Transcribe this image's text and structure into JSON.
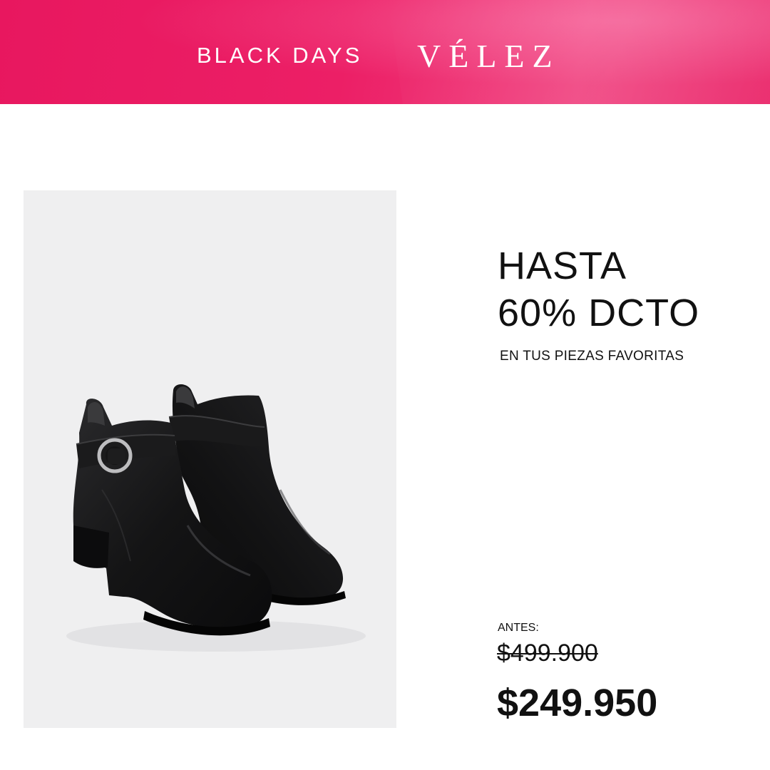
{
  "banner": {
    "campaign": "BLACK DAYS",
    "brand": "VÉLEZ",
    "colors": {
      "start": "#e8175f",
      "end": "#f0407e"
    }
  },
  "product": {
    "image": "black-ankle-boots-with-buckle-strap"
  },
  "promo": {
    "line1": "HASTA",
    "line2": "60% DCTO",
    "subtitle": "EN TUS PIEZAS FAVORITAS"
  },
  "pricing": {
    "before_label": "ANTES:",
    "before_price": "$499.900",
    "sale_price": "$249.950"
  }
}
